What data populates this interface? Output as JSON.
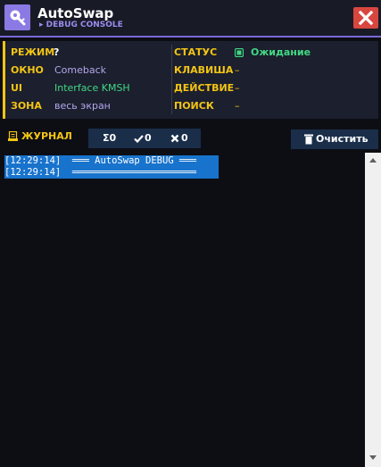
{
  "window": {
    "title": "AutoSwap",
    "subtitle": "▸ DEBUG CONSOLE",
    "accent_color": "#7b68d9",
    "close_color": "#d8473f"
  },
  "info": {
    "accent_color": "#f3c514",
    "left": [
      {
        "key": "РЕЖИМ",
        "value": "?"
      },
      {
        "key": "ОКНО",
        "value": "Comeback"
      },
      {
        "key": "UI",
        "value": "Interface KMSH"
      },
      {
        "key": "ЗОНА",
        "value": "весь экран"
      }
    ],
    "right": [
      {
        "key": "СТАТУС",
        "value": "Ожидание"
      },
      {
        "key": "КЛАВИША",
        "value": "–"
      },
      {
        "key": "ДЕЙСТВИЕ",
        "value": "–"
      },
      {
        "key": "ПОИСК",
        "value": "–"
      }
    ]
  },
  "toolbar": {
    "journal_label": "ЖУРНАЛ",
    "counters": {
      "total": "Σ0",
      "ok": "0",
      "fail": "0"
    },
    "clear_label": "Очистить"
  },
  "log": {
    "lines": [
      "[12:29:14]  ═══ AutoSwap DEBUG ═══",
      "[12:29:14]  ══════════════════════"
    ],
    "highlight_color": "#1873cc"
  }
}
